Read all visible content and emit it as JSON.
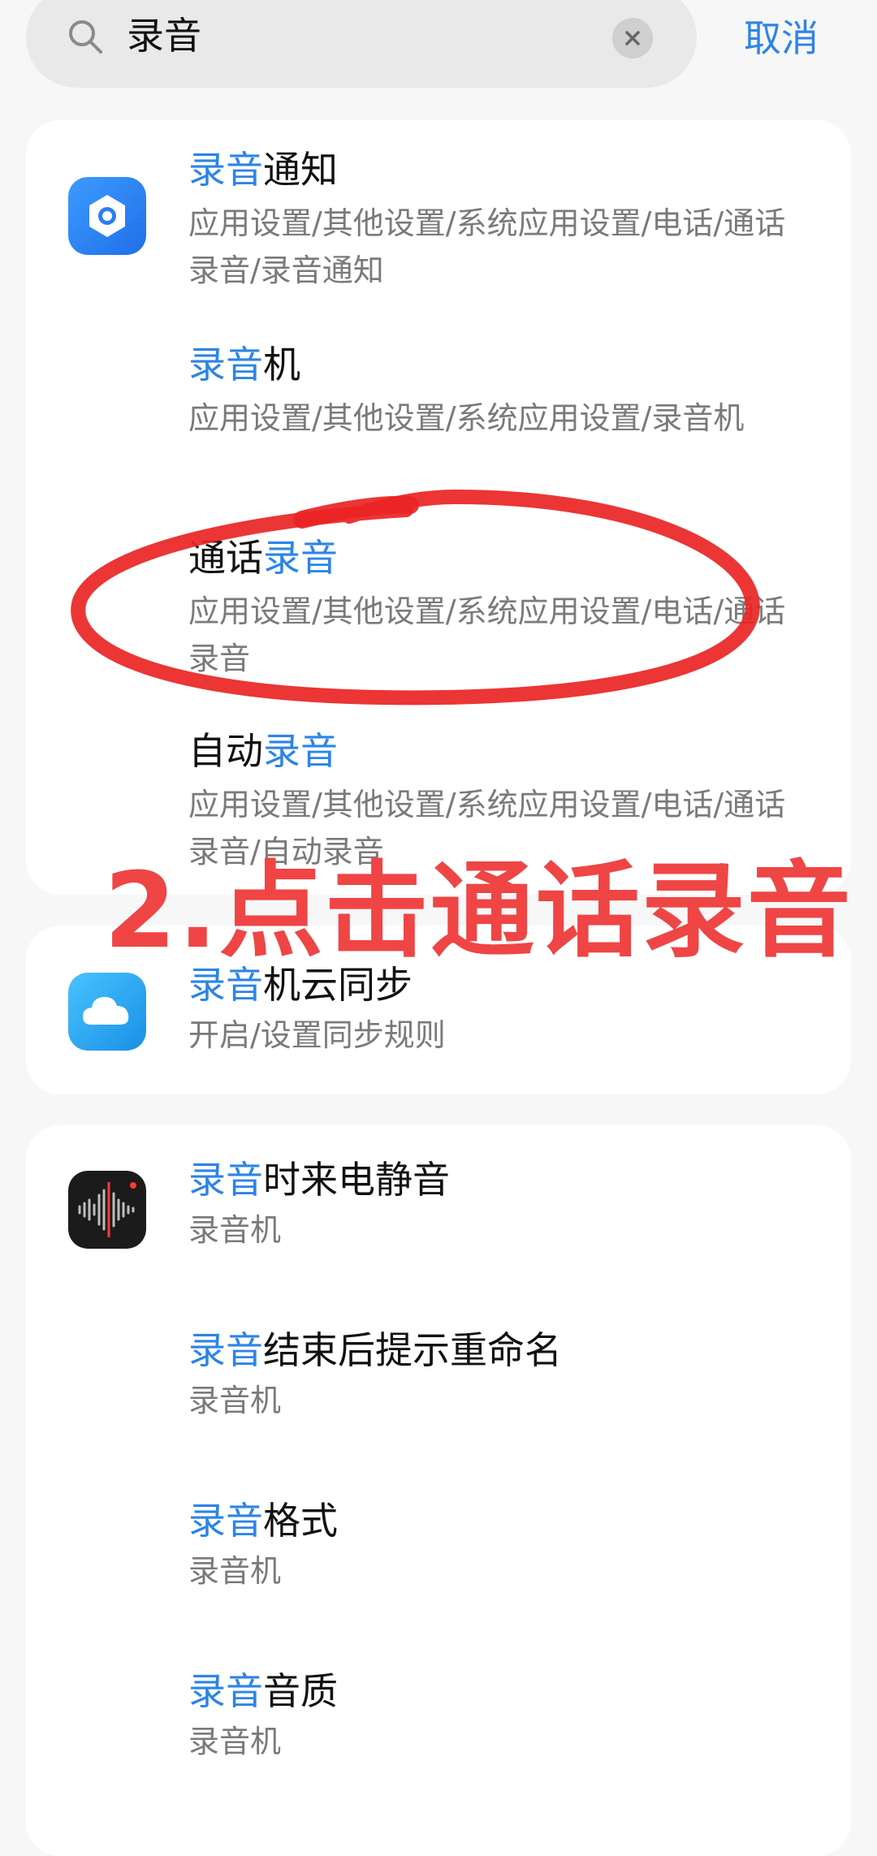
{
  "search": {
    "query": "录音",
    "cancel_label": "取消"
  },
  "results": {
    "group1": [
      {
        "highlight_before": "录音",
        "rest": "通知",
        "path": "应用设置/其他设置/系统应用设置/电话/通话录音/录音通知"
      },
      {
        "highlight_before": "录音",
        "rest": "机",
        "path": "应用设置/其他设置/系统应用设置/录音机"
      },
      {
        "plain_before": "通话",
        "highlight_after": "录音",
        "path": "应用设置/其他设置/系统应用设置/电话/通话录音"
      },
      {
        "plain_before": "自动",
        "highlight_after": "录音",
        "path": "应用设置/其他设置/系统应用设置/电话/通话录音/自动录音"
      }
    ],
    "group2": [
      {
        "highlight_before": "录音",
        "rest": "机云同步",
        "path": "开启/设置同步规则"
      }
    ],
    "group3": [
      {
        "highlight_before": "录音",
        "rest": "时来电静音",
        "path": "录音机"
      },
      {
        "highlight_before": "录音",
        "rest": "结束后提示重命名",
        "path": "录音机"
      },
      {
        "highlight_before": "录音",
        "rest": "格式",
        "path": "录音机"
      },
      {
        "highlight_before": "录音",
        "rest": "音质",
        "path": "录音机"
      }
    ]
  },
  "annotation": {
    "text": "2.点击通话录音",
    "color": "#ef4545"
  },
  "colors": {
    "accent": "#2c84e8",
    "background": "#f7f7f7",
    "card": "#ffffff",
    "secondary_text": "#7a7a7a"
  },
  "icons": {
    "group1": "settings-gear-icon",
    "group2": "cloud-icon",
    "group3": "voice-recorder-waveform-icon"
  }
}
